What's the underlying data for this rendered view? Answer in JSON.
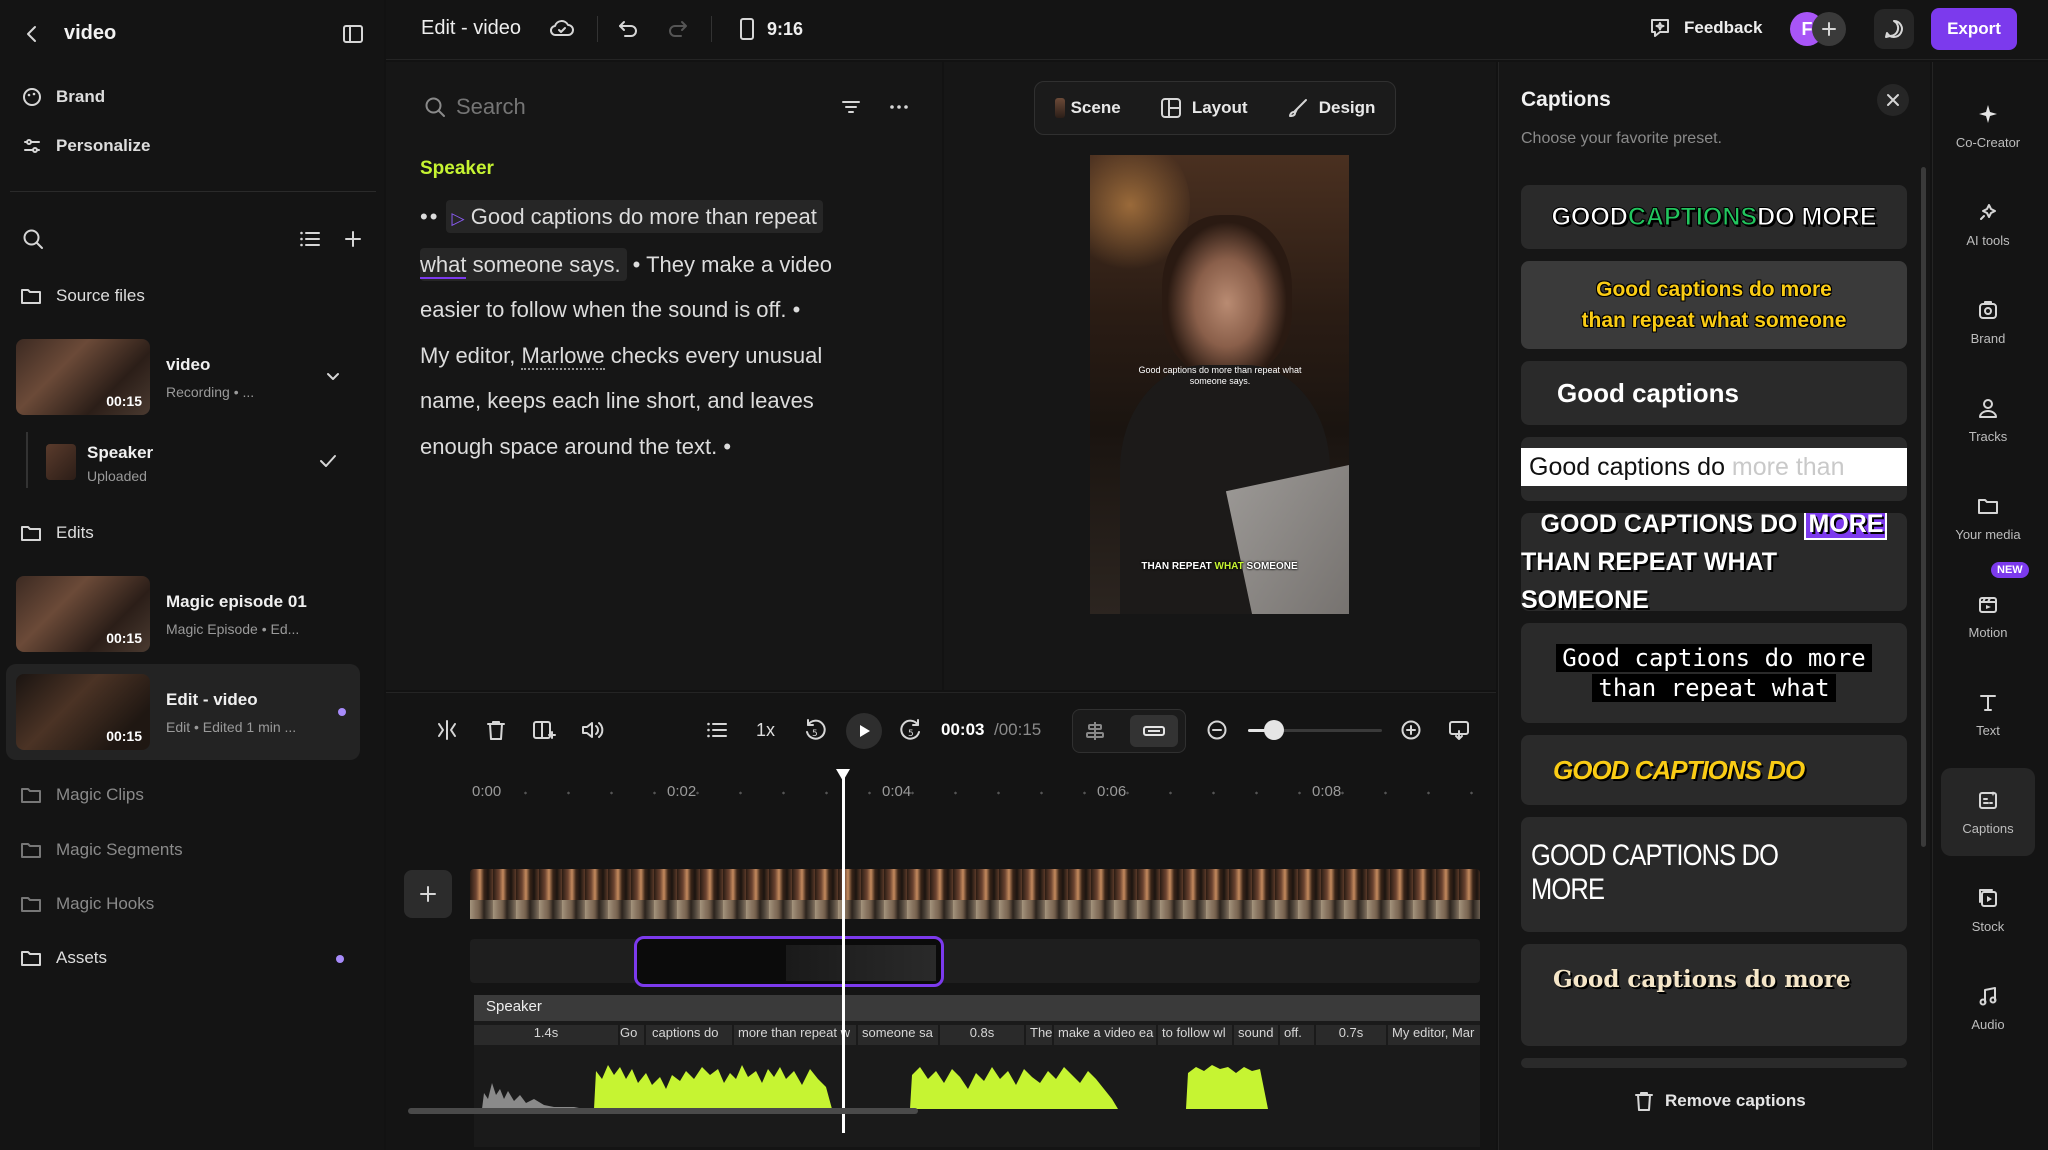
{
  "left": {
    "back_title": "video",
    "brand": "Brand",
    "personalize": "Personalize",
    "source_files": "Source files",
    "video": {
      "title": "video",
      "sub": "Recording • ...",
      "dur": "00:15"
    },
    "speaker": {
      "title": "Speaker",
      "sub": "Uploaded"
    },
    "edits": "Edits",
    "magic_ep": {
      "title": "Magic episode 01",
      "sub": "Magic Episode • Ed...",
      "dur": "00:15"
    },
    "edit_video": {
      "title": "Edit - video",
      "sub": "Edit • Edited 1 min ...",
      "dur": "00:15"
    },
    "folders": [
      "Magic Clips",
      "Magic Segments",
      "Magic Hooks",
      "Assets"
    ]
  },
  "topbar": {
    "title": "Edit - video",
    "ratio": "9:16",
    "feedback": "Feedback",
    "avatar": "F",
    "export": "Export"
  },
  "script": {
    "search_placeholder": "Search",
    "speaker": "Speaker",
    "seg1": "Good captions do more than repeat",
    "seg1b_sel": "what",
    "seg1c": " someone says.",
    "seg2a": "They make a video",
    "seg2b": "easier to follow when the sound is off.",
    "seg3a": "My editor, ",
    "seg3_name": "Marlowe",
    "seg3b": " checks every unusual",
    "seg3c": "name, keeps each line short, and leaves",
    "seg3d": "enough space around the text."
  },
  "preview": {
    "tabs": [
      "Scene",
      "Layout",
      "Design"
    ],
    "overlay_text": "Good captions do more than repeat what someone says.",
    "caption_a": "THAN REPEAT ",
    "caption_b": "WHAT",
    "caption_c": " SOMEONE"
  },
  "captions": {
    "title": "Captions",
    "subtitle": "Choose your favorite preset.",
    "p1a": "GOOD ",
    "p1b": "CAPTIONS",
    "p1c": " DO MORE",
    "p2": "Good captions do more\nthan repeat what someone",
    "p3": "Good captions",
    "p4a": "Good captions do ",
    "p4b": "more than",
    "p5a": "GOOD CAPTIONS DO ",
    "p5b": "MORE",
    "p5c": "THAN REPEAT WHAT SOMEONE",
    "p6a": "Good captions do more",
    "p6b": "than repeat what",
    "p7": "GOOD CAPTIONS DO",
    "p8": "GOOD CAPTIONS DO MORE",
    "p9": "Good captions do more",
    "remove": "Remove captions"
  },
  "rightbar": {
    "items": [
      "Co-Creator",
      "AI tools",
      "Brand",
      "Tracks",
      "Your media",
      "Motion",
      "Text",
      "Captions",
      "Stock",
      "Audio"
    ],
    "new_badge": "NEW"
  },
  "timeline": {
    "speed": "1x",
    "time_current": "00:03",
    "time_total": "/00:15",
    "ticks": [
      "0:00",
      "0:02",
      "0:04",
      "0:06",
      "0:08"
    ],
    "track_label": "Speaker",
    "words": [
      "1.4s",
      "Go",
      "captions do",
      "more than repeat w",
      "someone sa",
      "0.8s",
      "The",
      "make a video ea",
      "to follow wl",
      "sound",
      "off.",
      "0.7s",
      "My editor, Mar"
    ]
  },
  "colors": {
    "accent": "#7c3aed",
    "green": "#c6f432",
    "speaker": "#c6f432"
  }
}
